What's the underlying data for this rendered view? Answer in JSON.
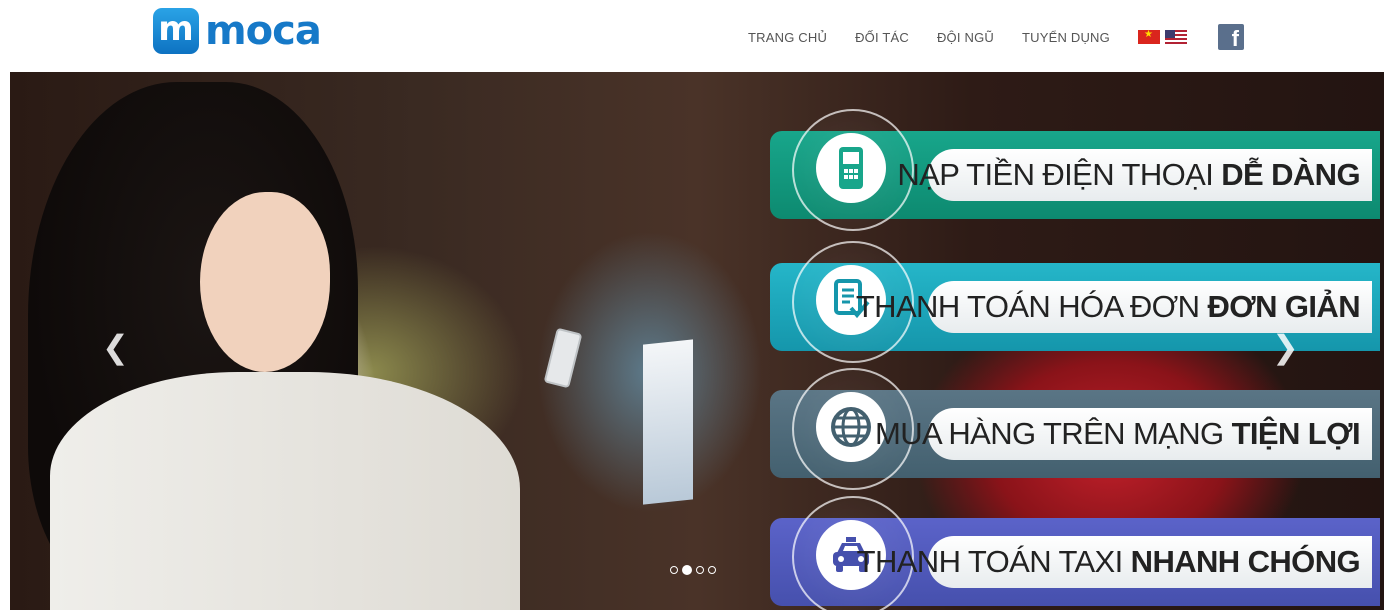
{
  "brand": {
    "logo_letter": "m",
    "logo_text": "moca"
  },
  "nav": {
    "items": [
      "TRANG CHỦ",
      "ĐỐI TÁC",
      "ĐỘI NGŨ",
      "TUYỂN DỤNG"
    ],
    "languages": [
      "vietnam-flag-icon",
      "us-flag-icon"
    ],
    "social": "facebook-icon",
    "facebook_glyph": "f"
  },
  "slider": {
    "prev_glyph": "❮",
    "next_glyph": "❯",
    "active_slide": 2,
    "slide_count": 4,
    "banners": [
      {
        "icon": "mobile-phone-icon",
        "text": "NẠP TIỀN ĐIỆN THOẠI",
        "bold": "DỄ DÀNG",
        "color": "#18a68b"
      },
      {
        "icon": "invoice-check-icon",
        "text": "THANH TOÁN HÓA ĐƠN",
        "bold": "ĐƠN GIẢN",
        "color": "#25b6c9"
      },
      {
        "icon": "globe-icon",
        "text": "MUA HÀNG TRÊN MẠNG",
        "bold": "TIỆN LỢI",
        "color": "#5a7585"
      },
      {
        "icon": "taxi-icon",
        "text": "THANH TOÁN TAXI",
        "bold": "NHANH CHÓNG",
        "color": "#5b63c9"
      }
    ]
  }
}
